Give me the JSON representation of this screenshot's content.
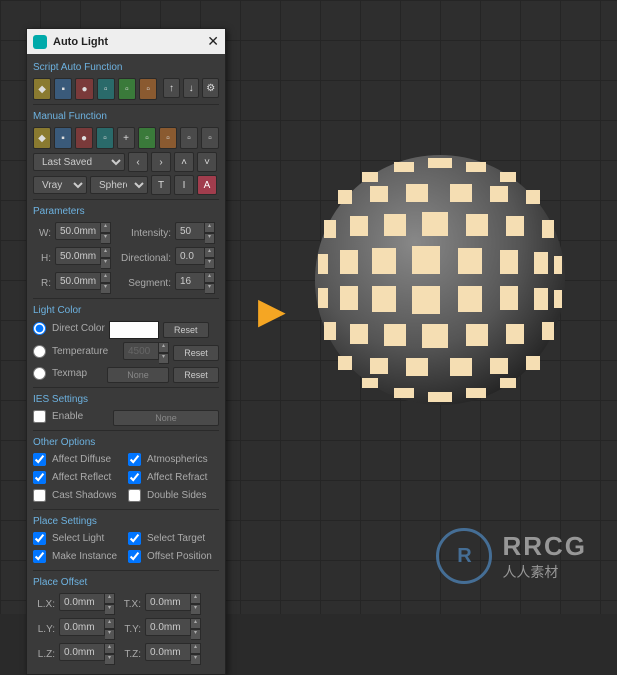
{
  "window": {
    "title": "Auto Light"
  },
  "sections": {
    "scriptAuto": "Script Auto Function",
    "manual": "Manual Function",
    "parameters": "Parameters",
    "lightColor": "Light Color",
    "ies": "IES Settings",
    "other": "Other Options",
    "placeSettings": "Place Settings",
    "placeOffset": "Place Offset"
  },
  "dropdowns": {
    "saved": "Last Saved",
    "renderer": "Vray",
    "shape": "Sphere"
  },
  "smallbtns": {
    "t": "T",
    "i": "I",
    "a": "A"
  },
  "params": {
    "w_label": "W:",
    "w": "50.0mm",
    "h_label": "H:",
    "h": "50.0mm",
    "r_label": "R:",
    "r": "50.0mm",
    "intensity_label": "Intensity:",
    "intensity": "50",
    "directional_label": "Directional:",
    "directional": "0.0",
    "segment_label": "Segment:",
    "segment": "16"
  },
  "lightColor": {
    "direct": "Direct Color",
    "temperature": "Temperature",
    "tempval": "4500",
    "texmap": "Texmap",
    "none": "None",
    "reset": "Reset"
  },
  "ies": {
    "enable": "Enable",
    "none": "None"
  },
  "other": {
    "diffuse": "Affect Diffuse",
    "atmos": "Atmospherics",
    "reflect": "Affect Reflect",
    "refract": "Affect Refract",
    "shadows": "Cast Shadows",
    "double": "Double Sides"
  },
  "place": {
    "selectLight": "Select Light",
    "selectTarget": "Select Target",
    "makeInstance": "Make Instance",
    "offsetPos": "Offset Position"
  },
  "offset": {
    "lx_label": "L.X:",
    "lx": "0.0mm",
    "ly_label": "L.Y:",
    "ly": "0.0mm",
    "lz_label": "L.Z:",
    "lz": "0.0mm",
    "tx_label": "T.X:",
    "tx": "0.0mm",
    "ty_label": "T.Y:",
    "ty": "0.0mm",
    "tz_label": "T.Z:",
    "tz": "0.0mm"
  },
  "watermark": {
    "big": "RRCG",
    "small": "人人素材"
  }
}
